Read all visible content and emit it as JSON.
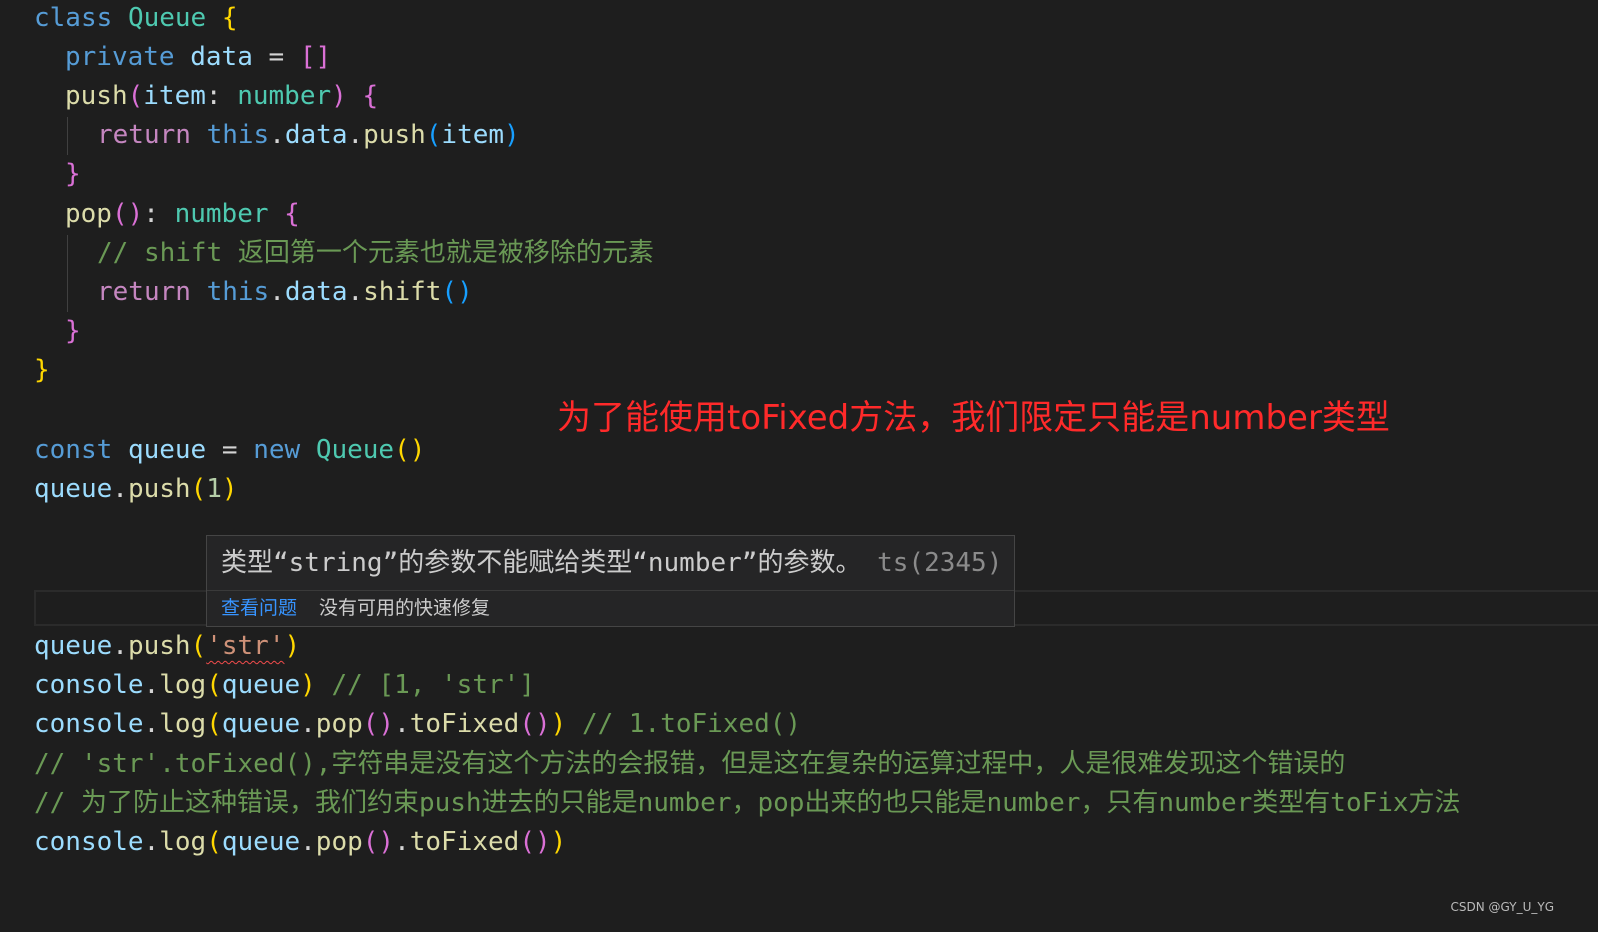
{
  "editor": {
    "language": "typescript",
    "theme_background": "#1e1e1e",
    "lines": {
      "l1": {
        "kw": "class",
        "cls": "Queue",
        "ob": "{"
      },
      "l2": {
        "kw": "private",
        "prop": "data",
        "eq": "=",
        "arr": "[]"
      },
      "l3": {
        "fn": "push",
        "op": "(",
        "param": "item",
        "colon": ":",
        "typ": "number",
        "cp": ")",
        "ob": "{"
      },
      "l4": {
        "kw": "return",
        "this": "this",
        "d1": ".",
        "prop": "data",
        "d2": ".",
        "fn": "push",
        "op": "(",
        "arg": "item",
        "cp": ")"
      },
      "l5": {
        "cb": "}"
      },
      "l6": {
        "fn": "pop",
        "parens": "()",
        "colon": ":",
        "typ": "number",
        "ob": "{"
      },
      "l7": {
        "cmt": "// shift 返回第一个元素也就是被移除的元素"
      },
      "l8": {
        "kw": "return",
        "this": "this",
        "d1": ".",
        "prop": "data",
        "d2": ".",
        "fn": "shift",
        "parens": "()"
      },
      "l9": {
        "cb": "}"
      },
      "l10": {
        "cb": "}"
      },
      "l11": {
        "kw": "const",
        "var": "queue",
        "eq": "=",
        "new": "new",
        "cls": "Queue",
        "parens": "()"
      },
      "l12": {
        "obj": "queue",
        "d": ".",
        "fn": "push",
        "op": "(",
        "num": "1",
        "cp": ")"
      },
      "l13": {
        "obj": "queue",
        "d": ".",
        "fn": "push",
        "op": "(",
        "str": "'str'",
        "cp": ")"
      },
      "l14": {
        "obj": "console",
        "d": ".",
        "fn": "log",
        "op": "(",
        "arg": "queue",
        "cp": ")",
        "cmt": "// [1, 'str']"
      },
      "l15": {
        "obj": "console",
        "d1": ".",
        "fn": "log",
        "op1": "(",
        "arg": "queue",
        "d2": ".",
        "fn2": "pop",
        "p2": "()",
        "d3": ".",
        "fn3": "toFixed",
        "p3": "()",
        "cp1": ")",
        "cmt": "// 1.toFixed()"
      },
      "l16": {
        "cmt": "// 'str'.toFixed(),字符串是没有这个方法的会报错，但是这在复杂的运算过程中，人是很难发现这个错误的"
      },
      "l17": {
        "cmt": "// 为了防止这种错误，我们约束push进去的只能是number，pop出来的也只能是number，只有number类型有toFix方法"
      },
      "l18": {
        "obj": "console",
        "d1": ".",
        "fn": "log",
        "op1": "(",
        "arg": "queue",
        "d2": ".",
        "fn2": "pop",
        "p2": "()",
        "d3": ".",
        "fn3": "toFixed",
        "p3": "()",
        "cp1": ")"
      }
    }
  },
  "annotation": {
    "text": "为了能使用toFixed方法，我们限定只能是number类型",
    "color": "#ff2a2a"
  },
  "hover": {
    "message": "类型“string”的参数不能赋给类型“number”的参数。",
    "code": "ts(2345)",
    "view_problem": "查看问题",
    "no_quick_fix": "没有可用的快速修复"
  },
  "watermark": "CSDN @GY_U_YG"
}
